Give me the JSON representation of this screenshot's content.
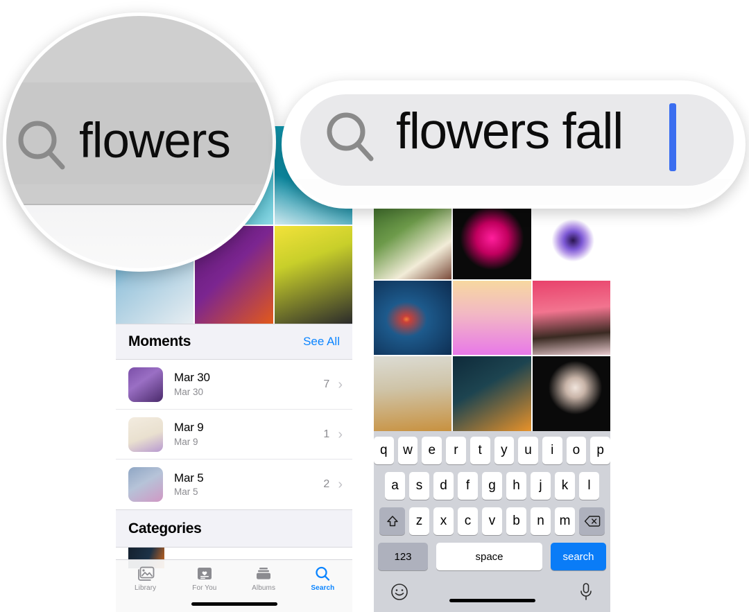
{
  "app": {
    "name": "Photos",
    "accent_blue": "#0a84ff",
    "keyboard_return_blue": "#0a7cf7"
  },
  "magnifier_left": {
    "name": "search-field-zoom-before",
    "search_icon": "search-icon",
    "query_text": "flowers"
  },
  "magnifier_right": {
    "name": "search-field-zoom-after",
    "search_icon": "search-icon",
    "query_text": "flowers fall",
    "caret_color": "#3b6ef0"
  },
  "left_panel": {
    "photo_grid": {
      "name": "results-photo-grid",
      "rows": 2,
      "columns": 3,
      "cells": [
        {
          "alt": "pink-blossom-photo",
          "css": "linear-gradient(150deg,#9fd3e6 0%,#e8b8c6 45%,#d8e4ee 100%)"
        },
        {
          "alt": "teal-cherry-blossom-photo",
          "css": "linear-gradient(135deg,#0e94ad 0%,#1ba7bd 50%,#8fd8e4 100%)"
        },
        {
          "alt": "teal-blossom-photo-2",
          "css": "linear-gradient(200deg,#12a0b8 0%,#0d8ba3 60%,#cfe9ef 100%)"
        },
        {
          "alt": "frosted-blue-branch-photo",
          "css": "linear-gradient(140deg,#2f9fd4 0%,#9fc8de 40%,#e8eef2 100%)"
        },
        {
          "alt": "purple-orange-bubbles-photo",
          "css": "linear-gradient(135deg,#5d1a72 0%,#7b2590 45%,#e2591a 100%)"
        },
        {
          "alt": "black-puppy-daffodils-photo",
          "css": "linear-gradient(160deg,#f2e23a 0%,#c8cf2a 35%,#2b2b2b 100%)"
        }
      ]
    },
    "moments": {
      "header": "Moments",
      "see_all": "See All",
      "rows": [
        {
          "title": "Mar 30",
          "subtitle": "Mar 30",
          "count": "7",
          "chevron": "chevron-right-icon",
          "thumb_css": "linear-gradient(145deg,#7b4fa8 0%,#9a6fc4 40%,#4a2a6b 100%)"
        },
        {
          "title": "Mar 9",
          "subtitle": "Mar 9",
          "count": "1",
          "chevron": "chevron-right-icon",
          "thumb_css": "linear-gradient(160deg,#f3ece0 0%,#e9e0cf 55%,#b89ad0 100%)"
        },
        {
          "title": "Mar 5",
          "subtitle": "Mar 5",
          "count": "2",
          "chevron": "chevron-right-icon",
          "thumb_css": "linear-gradient(150deg,#8fa6c4 0%,#b6c3d8 45%,#d098c4 100%)"
        }
      ]
    },
    "categories": {
      "header": "Categories",
      "strip_css": "linear-gradient(110deg,#14202e 0%,#1d3247 55%,#d4681a 100%)"
    },
    "tabbar": {
      "items": [
        {
          "label": "Library",
          "icon": "photos-library-icon",
          "active": false
        },
        {
          "label": "For You",
          "icon": "for-you-heart-card-icon",
          "active": false
        },
        {
          "label": "Albums",
          "icon": "albums-stack-icon",
          "active": false
        },
        {
          "label": "Search",
          "icon": "search-icon",
          "active": true
        }
      ]
    }
  },
  "right_panel": {
    "photo_grid": {
      "name": "results-photo-grid",
      "rows": 3,
      "columns": 3,
      "cells": [
        {
          "alt": "white-bell-flowers-green-leaves-photo",
          "css": "linear-gradient(145deg,#3d6b2a 0%,#6d9a4a 35%,#f2ecd8 70%,#7a4a3a 100%)"
        },
        {
          "alt": "magenta-dahlia-on-black-photo",
          "css": "radial-gradient(circle at 50% 45%, #ff1f9c 0%, #c2005f 28%, #0a0a0a 56%)"
        },
        {
          "alt": "purple-anemone-on-white-photo",
          "css": "radial-gradient(circle at 52% 48%, #2a1550 0%, #7b57d4 16%, #b79ae8 26%, #ffffff 38%)"
        },
        {
          "alt": "red-leaf-on-blue-water-photo",
          "css": "radial-gradient(ellipse at 42% 52%, #f2803a 0%, #c8413a 6%, #1d5a8c 32%, #0d2c50 100%)"
        },
        {
          "alt": "purple-iris-gradient-photo",
          "css": "linear-gradient(180deg,#f7d8a0 0%,#f2b8c4 45%,#e878e8 100%)"
        },
        {
          "alt": "pink-autumn-tree-photo",
          "css": "linear-gradient(175deg,#e8416b 0%,#f2748f 40%,#3a2a22 72%,#e6c8cc 100%)"
        },
        {
          "alt": "blue-cornflowers-field-photo",
          "css": "linear-gradient(175deg,#dcdcd4 0%,#cfc4a8 42%,#c8913f 100%)"
        },
        {
          "alt": "orange-tulips-dark-photo",
          "css": "linear-gradient(150deg,#0e2a3a 0%,#1d4450 40%,#e8922a 100%)"
        },
        {
          "alt": "pale-flower-on-black-photo",
          "css": "radial-gradient(circle at 55% 42%, #f0e4dc 0%, #c8b4a8 16%, #0a0a0a 44%)"
        }
      ]
    },
    "keyboard": {
      "name": "ios-qwerty-keyboard",
      "row1": [
        "q",
        "w",
        "e",
        "r",
        "t",
        "y",
        "u",
        "i",
        "o",
        "p"
      ],
      "row2": [
        "a",
        "s",
        "d",
        "f",
        "g",
        "h",
        "j",
        "k",
        "l"
      ],
      "row3": [
        "z",
        "x",
        "c",
        "v",
        "b",
        "n",
        "m"
      ],
      "shift_key": {
        "label": "",
        "icon": "shift-arrow-up-icon"
      },
      "delete_key": {
        "label": "",
        "icon": "backspace-delete-icon"
      },
      "numbers_key": "123",
      "space_key": "space",
      "return_key": "search",
      "emoji_key": {
        "label": "",
        "icon": "emoji-smiley-icon"
      },
      "dictation_key": {
        "label": "",
        "icon": "microphone-icon"
      }
    }
  }
}
